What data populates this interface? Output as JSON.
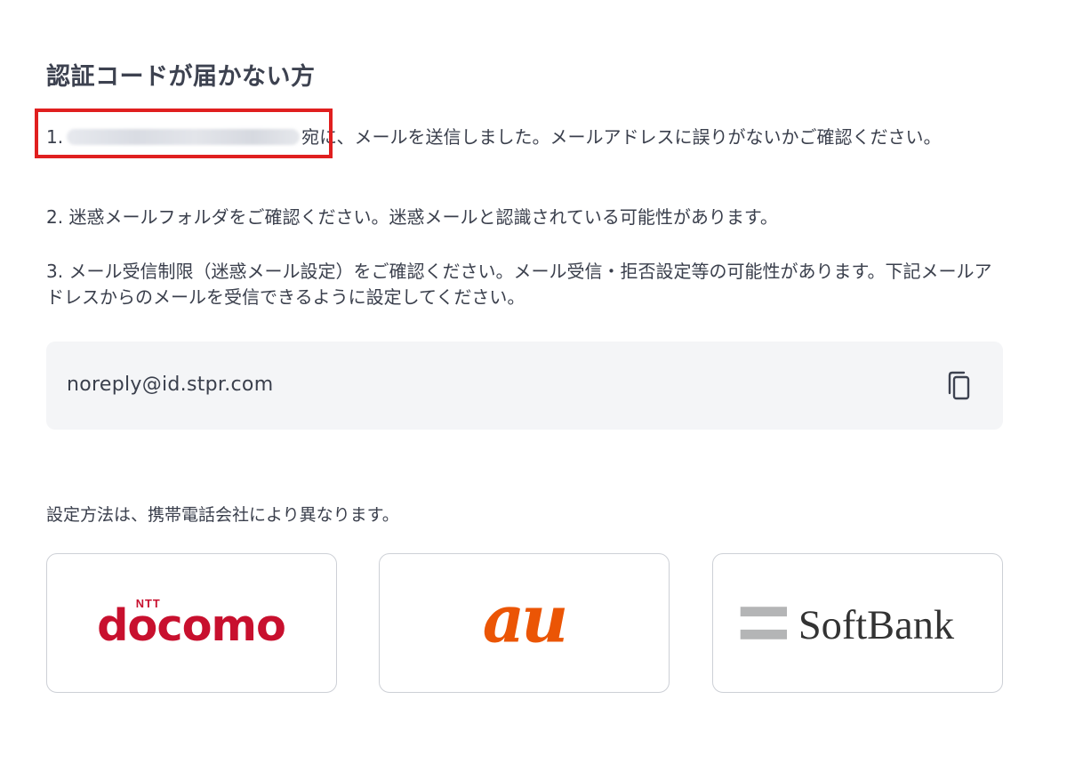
{
  "heading": "認証コードが届かない方",
  "items": [
    {
      "prefix": "1.",
      "text": "宛に、メールを送信しました。メールアドレスに誤りがないかご確認ください。"
    },
    {
      "text": "2. 迷惑メールフォルダをご確認ください。迷惑メールと認識されている可能性があります。"
    },
    {
      "text": "3. メール受信制限（迷惑メール設定）をご確認ください。メール受信・拒否設定等の可能性があります。下記メールアドレスからのメールを受信できるように設定してください。"
    }
  ],
  "sender_email": {
    "address": "noreply@id.stpr.com",
    "copy_icon": "copy-icon"
  },
  "carrier_note": "設定方法は、携帯電話会社により異なります。",
  "carriers": [
    {
      "name": "docomo",
      "logo_top": "NTT",
      "logo_text": "docomo",
      "color": "#c8102e"
    },
    {
      "name": "au",
      "logo_text": "au",
      "color": "#eb5505"
    },
    {
      "name": "SoftBank",
      "logo_text": "SoftBank",
      "color": "#333333",
      "bar_color": "#b4b5b6"
    }
  ],
  "colors": {
    "text": "#3a3f4c",
    "highlight_border": "#e01f1f",
    "email_box_bg": "#f4f5f7",
    "card_border": "#cdd0d6"
  }
}
